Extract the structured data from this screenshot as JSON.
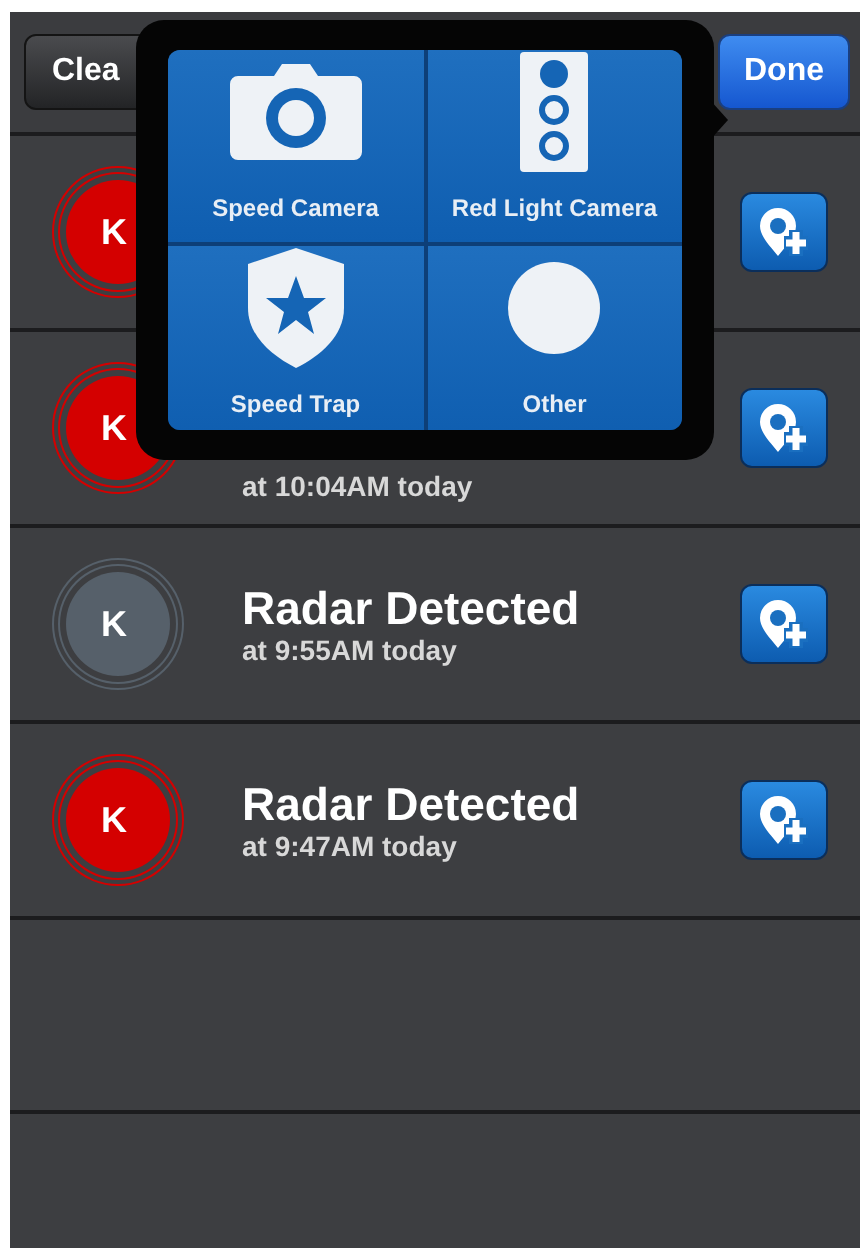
{
  "toolbar": {
    "clear_button": "Clea",
    "done_button": "Done"
  },
  "popover": {
    "options": [
      {
        "label": "Speed Camera",
        "kind": "camera"
      },
      {
        "label": "Red Light Camera",
        "kind": "traffic-light"
      },
      {
        "label": "Speed Trap",
        "kind": "shield"
      },
      {
        "label": "Other",
        "kind": "circle"
      }
    ]
  },
  "alerts": [
    {
      "badge": "K",
      "color": "#d40000"
    },
    {
      "badge": "K",
      "color": "#d40000",
      "subtitle": "at 10:04AM today"
    },
    {
      "badge": "K",
      "color": "#56606a",
      "title": "Radar Detected",
      "subtitle": "at 9:55AM today"
    },
    {
      "badge": "K",
      "color": "#d40000",
      "title": "Radar Detected",
      "subtitle": "at 9:47AM today"
    }
  ]
}
